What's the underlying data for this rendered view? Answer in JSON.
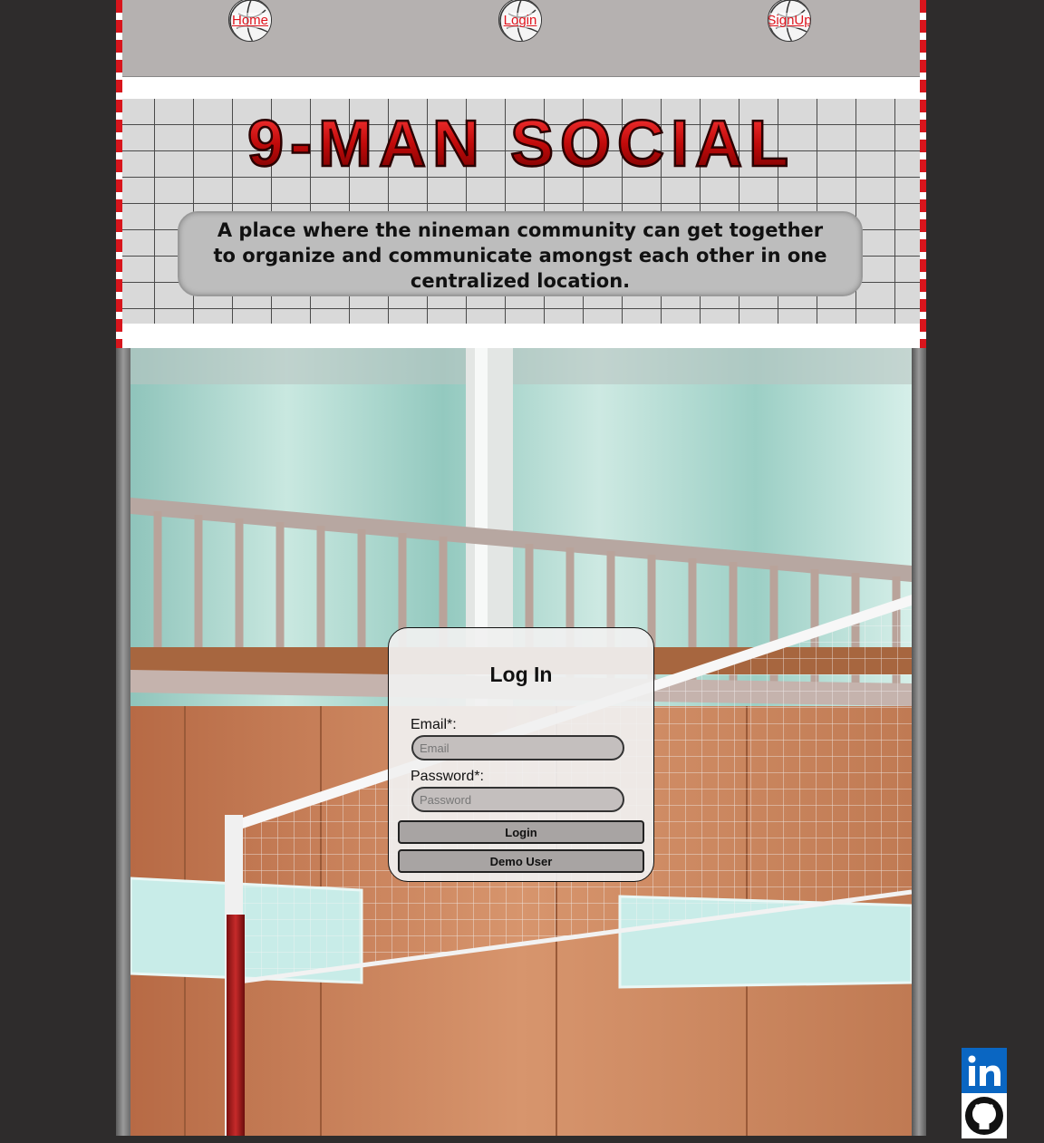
{
  "nav": {
    "home_label": "Home",
    "login_label": "Login",
    "signup_label": "SignUp",
    "link_color": "#e0141d"
  },
  "header": {
    "logo_text": "9-MAN SOCIAL",
    "tagline": "A place where the nineman community can get together to organize and communicate amongst each other in one centralized location."
  },
  "login": {
    "title": "Log In",
    "email_label": "Email*:",
    "email_placeholder": "Email",
    "email_value": "",
    "password_label": "Password*:",
    "password_placeholder": "Password",
    "password_value": "",
    "login_button": "Login",
    "demo_button": "Demo User"
  },
  "social": {
    "linkedin_icon": "linkedin-icon",
    "github_icon": "github-icon",
    "linkedin_color": "#0a66c2"
  },
  "colors": {
    "page_bg": "#2e2c2c",
    "navbar_bg": "#b5b1b0",
    "stripe_red": "#d8151c"
  }
}
